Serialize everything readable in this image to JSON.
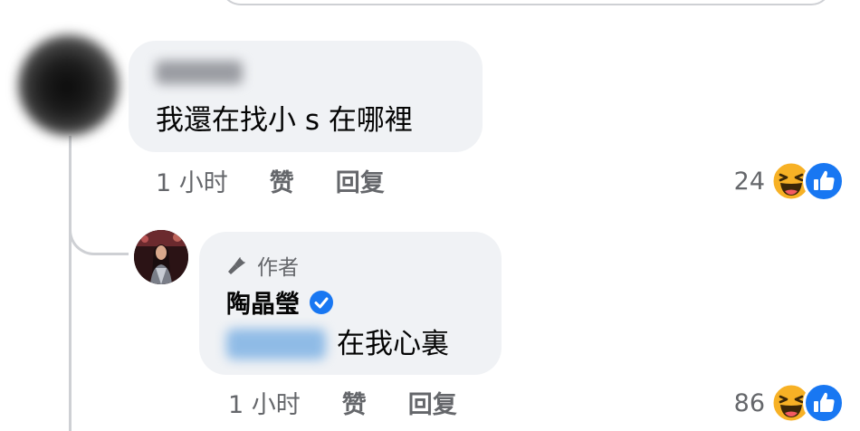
{
  "comment": {
    "author_name": "",
    "text": "我還在找小 s 在哪裡",
    "time": "1 小时",
    "like_label": "赞",
    "reply_label": "回复",
    "reaction_count": "24",
    "reaction_icons": [
      "haha-icon",
      "like-icon"
    ]
  },
  "reply": {
    "author_badge": "作者",
    "author_name": "陶晶瑩",
    "verified": true,
    "mention": "",
    "text": "在我心裏",
    "time": "1 小时",
    "like_label": "赞",
    "reply_label": "回复",
    "reaction_count": "86",
    "reaction_icons": [
      "haha-icon",
      "like-icon"
    ]
  },
  "colors": {
    "bubble": "#f0f2f5",
    "meta_text": "#65676b",
    "facebook_blue": "#1877f2",
    "haha_yellow": "#f7b125",
    "thread_line": "#ced0d4"
  }
}
